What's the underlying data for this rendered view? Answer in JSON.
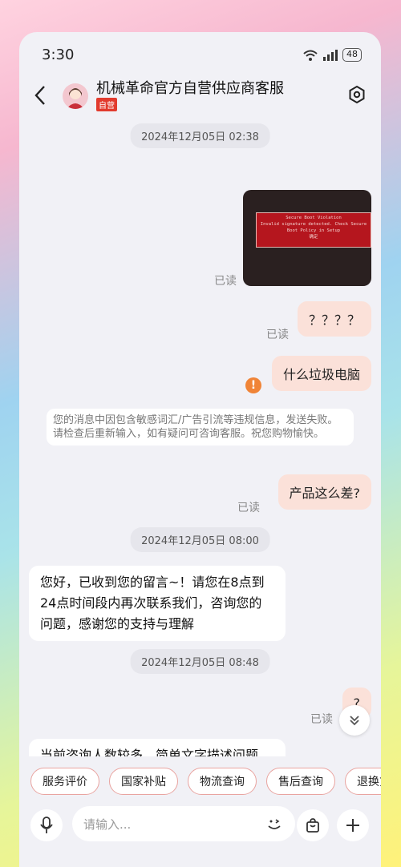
{
  "status": {
    "time": "3:30",
    "battery": "48"
  },
  "header": {
    "title": "机械革命官方自营供应商客服",
    "badge": "自营"
  },
  "messages": {
    "ts1": "2024年12月05日  02:38",
    "image_read": "已读",
    "bios": {
      "title": "Secure Boot Violation",
      "text": "Invalid signature detected. Check Secure Boot Policy in Setup",
      "ok": "确定"
    },
    "q4": "？？？？",
    "q4_read": "已读",
    "trash": "什么垃圾电脑",
    "warn_icon": "!",
    "system": "您的消息中因包含敏感词汇/广告引流等违规信息，发送失败。请检查后重新输入，如有疑问可咨询客服。祝您购物愉快。",
    "bad": "产品这么差?",
    "bad_read": "已读",
    "ts2": "2024年12月05日  08:00",
    "reply1": "您好，已收到您的留言~！请您在8点到24点时间段内再次联系我们，咨询您的问题，感谢您的支持与理解",
    "ts3": "2024年12月05日  08:48",
    "q1": "?",
    "q1_read": "已读",
    "reply2": "当前咨询人数较多，简单文字描述问题，以便尽快为您解答，感谢您的理解和配合，谢谢~"
  },
  "chips": [
    "服务评价",
    "国家补贴",
    "物流查询",
    "售后查询",
    "退换货"
  ],
  "input": {
    "placeholder": "请输入..."
  }
}
